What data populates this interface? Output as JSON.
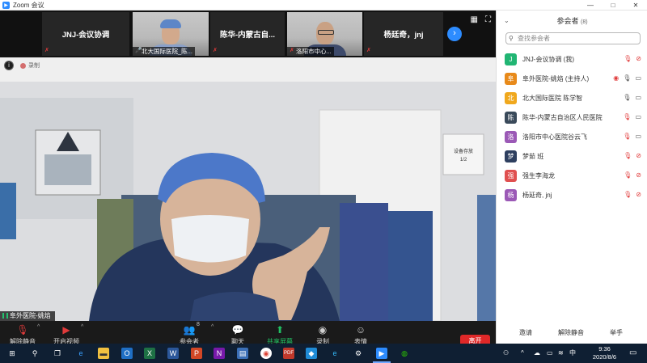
{
  "window": {
    "title": "Zoom 会议",
    "controls": [
      "—",
      "□",
      "✕"
    ]
  },
  "thumbnails": [
    {
      "label": "JNJ-会议协调",
      "type": "name"
    },
    {
      "caption": "北大国际医院_陈...",
      "type": "video"
    },
    {
      "label": "陈华-内蒙古自...",
      "type": "name"
    },
    {
      "caption": "洛阳市中心...",
      "type": "video"
    },
    {
      "label": "杨廷奇，jnj",
      "type": "name"
    }
  ],
  "main_video": {
    "recording_label": "录制",
    "speaker_label": "阜外医院-姚焰",
    "sign_text": "设备存放",
    "sign_sub": "1/2"
  },
  "toolbar": {
    "unmute": "解除静音",
    "start_video": "开启视频",
    "participants": "参会者",
    "participants_count": "8",
    "chat": "聊天",
    "share_screen": "共享屏幕",
    "record": "录制",
    "reactions": "表情",
    "leave": "离开"
  },
  "panel": {
    "title": "参会者",
    "count": "(8)",
    "search_placeholder": "查找参会者",
    "participants": [
      {
        "initial": "J",
        "name": "JNJ-会议协调 (我)",
        "color": "#21b573",
        "mic": "muted",
        "video": "off"
      },
      {
        "initial": "阜",
        "name": "阜外医院-姚焰 (主持人)",
        "color": "#e88a1a",
        "mic": "active",
        "video": "on"
      },
      {
        "initial": "北",
        "name": "北大国际医院 陈学智",
        "color": "#f0a81d",
        "mic": "on",
        "video": "on"
      },
      {
        "initial": "陈",
        "name": "陈华-内蒙古自治区人民医院",
        "color": "#3a4a5a",
        "mic": "muted",
        "video": "on"
      },
      {
        "initial": "洛",
        "name": "洛阳市中心医院谷云飞",
        "color": "#9b59b6",
        "mic": "muted",
        "video": "on"
      },
      {
        "initial": "梦",
        "name": "梦茹 班",
        "color": "#2e3f5f",
        "mic": "muted",
        "video": "off"
      },
      {
        "initial": "强",
        "name": "强生李海龙",
        "color": "#e05050",
        "mic": "muted",
        "video": "off"
      },
      {
        "initial": "杨",
        "name": "杨延奇, jnj",
        "color": "#9b59b6",
        "mic": "muted",
        "video": "off"
      }
    ],
    "footer": {
      "invite": "邀请",
      "unmute_all": "解除静音",
      "raise_hand": "举手"
    }
  },
  "taskbar": {
    "time": "9:36",
    "date": "2020/8/6",
    "ime": "中",
    "apps": [
      "start",
      "search",
      "task-view",
      "edge",
      "explorer",
      "outlook",
      "excel",
      "word",
      "powerpoint",
      "onenote",
      "chrome",
      "app",
      "app2",
      "edge-new",
      "settings",
      "zoom",
      "wechat"
    ]
  }
}
